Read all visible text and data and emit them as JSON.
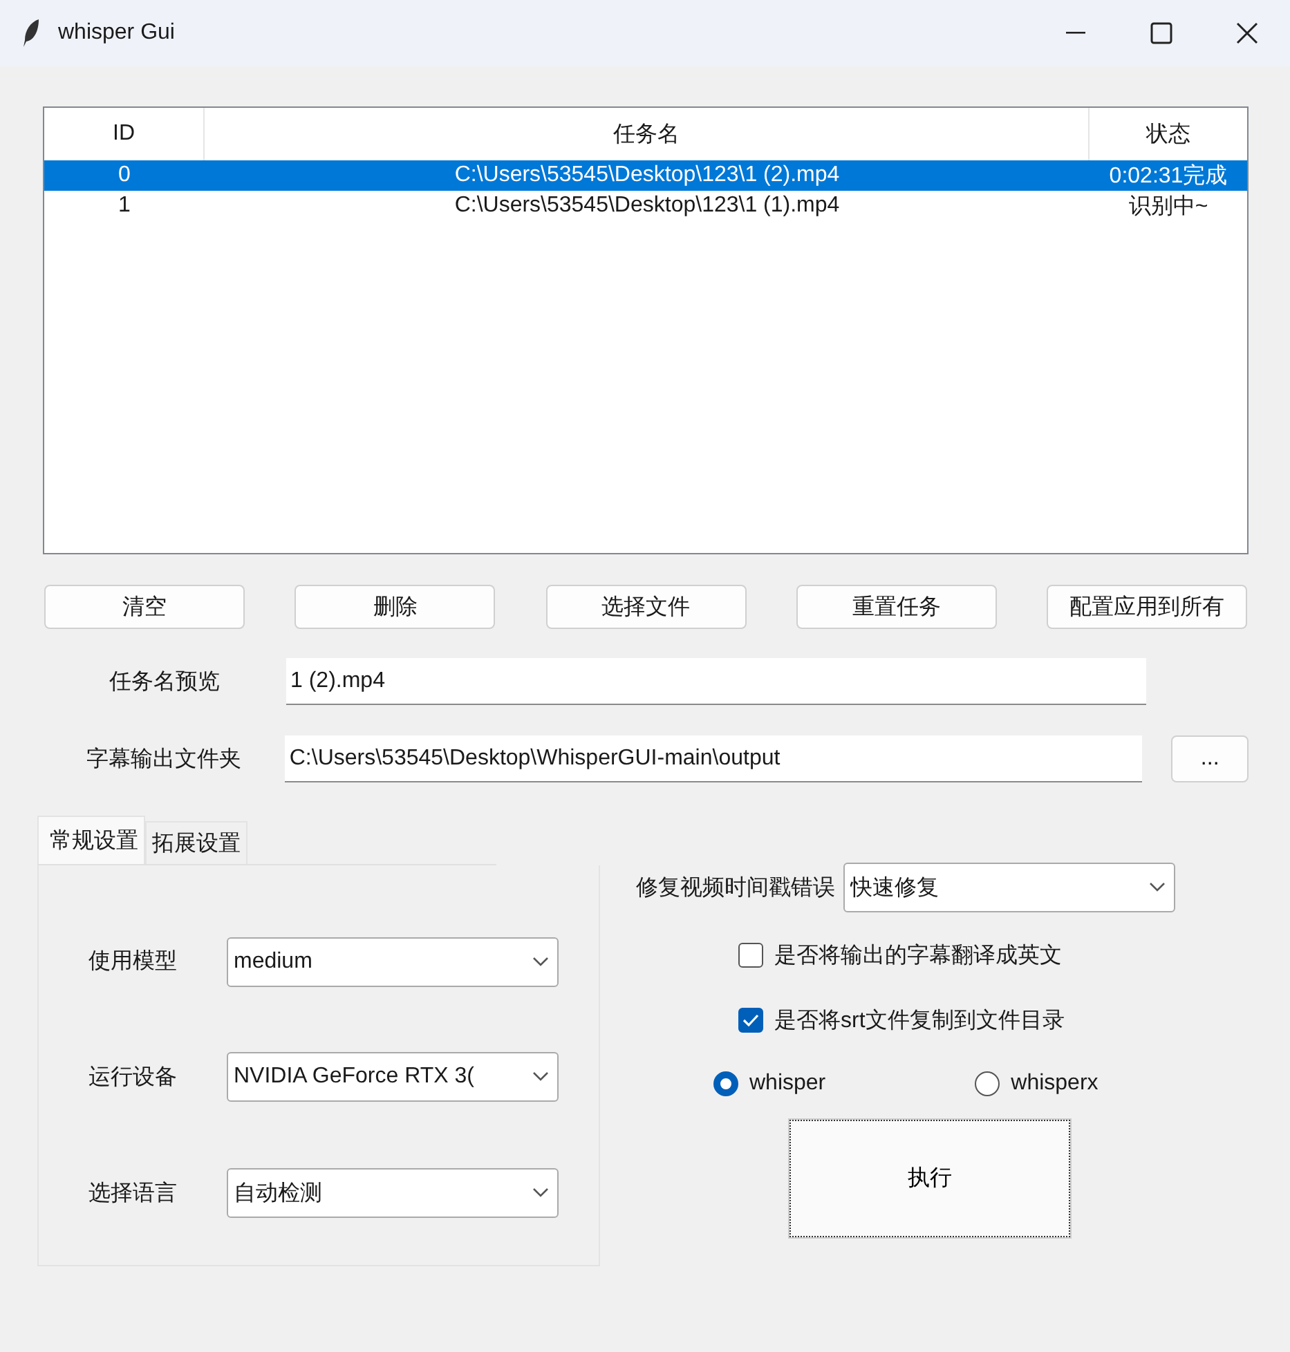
{
  "window": {
    "title": "whisper Gui"
  },
  "table": {
    "columns": [
      "ID",
      "任务名",
      "状态"
    ],
    "rows": [
      {
        "id": "0",
        "name": "C:\\Users\\53545\\Desktop\\123\\1 (2).mp4",
        "status": "0:02:31完成",
        "selected": true
      },
      {
        "id": "1",
        "name": "C:\\Users\\53545\\Desktop\\123\\1 (1).mp4",
        "status": "识别中~",
        "selected": false
      }
    ]
  },
  "buttons": [
    "清空",
    "删除",
    "选择文件",
    "重置任务",
    "配置应用到所有"
  ],
  "task_name_preview": {
    "label": "任务名预览",
    "value": "1 (2).mp4"
  },
  "output_folder": {
    "label": "字幕输出文件夹",
    "value": "C:\\Users\\53545\\Desktop\\WhisperGUI-main\\output",
    "button": "..."
  },
  "tabs": [
    {
      "label": "常规设置",
      "selected": true
    },
    {
      "label": "拓展设置",
      "selected": false
    }
  ],
  "general_settings": [
    {
      "label": "使用模型",
      "value": "medium"
    },
    {
      "label": "运行设备",
      "value": "NVIDIA GeForce RTX 3("
    },
    {
      "label": "选择语言",
      "value": "自动检测"
    }
  ],
  "timestamp_fix": {
    "label": "修复视频时间戳错误",
    "value": "快速修复"
  },
  "checkboxes": [
    {
      "label": "是否将输出的字幕翻译成英文",
      "checked": false
    },
    {
      "label": "是否将srt文件复制到文件目录",
      "checked": true
    }
  ],
  "engines": [
    {
      "label": "whisper",
      "selected": true
    },
    {
      "label": "whisperx",
      "selected": false
    }
  ],
  "execute_button": "执行"
}
